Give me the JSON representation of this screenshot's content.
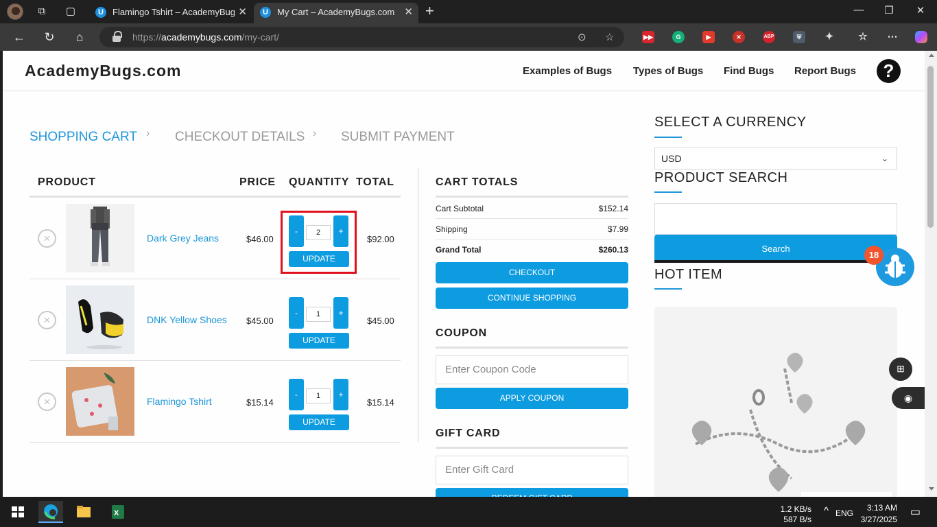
{
  "browser": {
    "tabs": [
      {
        "title": "Flamingo Tshirt – AcademyBugs.com",
        "favicon": "U"
      },
      {
        "title": "My Cart – AcademyBugs.com",
        "favicon": "U"
      }
    ],
    "url_prefix": "https://",
    "url_host": "academybugs.com",
    "url_path": "/my-cart/"
  },
  "site": {
    "logo": "AcademyBugs.com",
    "nav": [
      "Examples of Bugs",
      "Types of Bugs",
      "Find Bugs",
      "Report Bugs"
    ],
    "help_glyph": "?"
  },
  "breadcrumb": [
    "SHOPPING CART",
    "CHECKOUT DETAILS",
    "SUBMIT PAYMENT"
  ],
  "cart": {
    "headers": {
      "product": "PRODUCT",
      "price": "PRICE",
      "quantity": "QUANTITY",
      "total": "TOTAL"
    },
    "items": [
      {
        "name": "Dark Grey Jeans",
        "price": "$46.00",
        "qty": "2",
        "total": "$92.00",
        "minus": "-",
        "plus": "+",
        "update": "UPDATE",
        "remove": "×"
      },
      {
        "name": "DNK Yellow Shoes",
        "price": "$45.00",
        "qty": "1",
        "total": "$45.00",
        "minus": "-",
        "plus": "+",
        "update": "UPDATE",
        "remove": "×"
      },
      {
        "name": "Flamingo Tshirt",
        "price": "$15.14",
        "qty": "1",
        "total": "$15.14",
        "minus": "-",
        "plus": "+",
        "update": "UPDATE",
        "remove": "×"
      }
    ]
  },
  "totals": {
    "title": "CART TOTALS",
    "rows": [
      {
        "label": "Cart Subtotal",
        "value": "$152.14"
      },
      {
        "label": "Shipping",
        "value": "$7.99"
      },
      {
        "label": "Grand Total",
        "value": "$260.13"
      }
    ],
    "checkout": "CHECKOUT",
    "continue": "CONTINUE SHOPPING"
  },
  "coupon": {
    "title": "COUPON",
    "placeholder": "Enter Coupon Code",
    "button": "APPLY COUPON"
  },
  "giftcard": {
    "title": "GIFT CARD",
    "placeholder": "Enter Gift Card",
    "button": "REDEEM GIFT CARD"
  },
  "sidebar": {
    "currency_title": "SELECT A CURRENCY",
    "currency_value": "USD",
    "search_title": "PRODUCT SEARCH",
    "search_button": "Search",
    "hot_title": "HOT ITEM",
    "bug_badge": "18"
  },
  "taskbar": {
    "net_up": "1.2 KB/s",
    "net_down": "587 B/s",
    "lang": "ENG",
    "time": "3:13 AM",
    "date": "3/27/2025"
  },
  "colors": {
    "accent": "#0d9ce0",
    "link": "#1e96d8",
    "highlight": "#e0101c"
  }
}
